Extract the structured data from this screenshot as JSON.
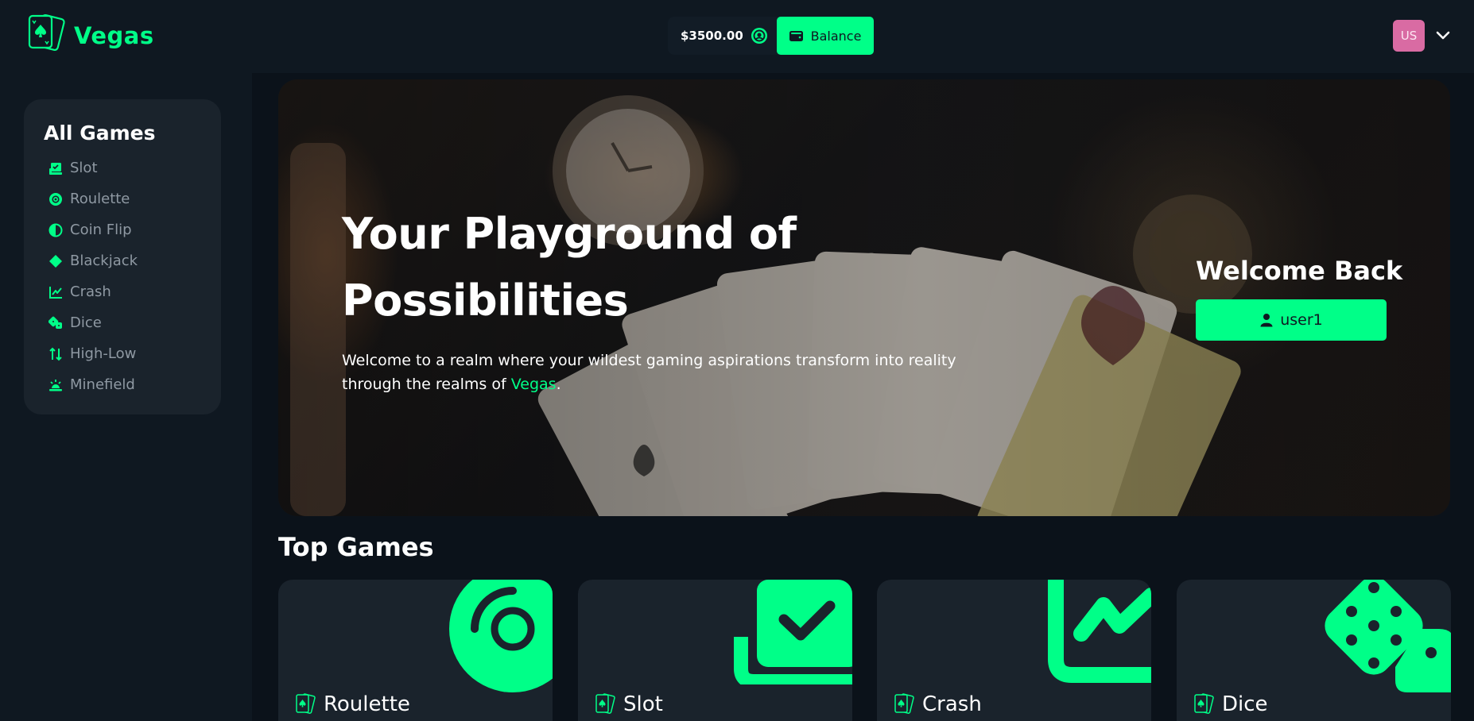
{
  "header": {
    "brand": "Vegas",
    "balance_amount": "$3500.00",
    "balance_label": "Balance",
    "avatar_initials": "US"
  },
  "sidebar": {
    "title": "All Games",
    "items": [
      {
        "label": "Slot",
        "icon": "slot-icon"
      },
      {
        "label": "Roulette",
        "icon": "roulette-icon"
      },
      {
        "label": "Coin Flip",
        "icon": "coin-flip-icon"
      },
      {
        "label": "Blackjack",
        "icon": "diamond-icon"
      },
      {
        "label": "Crash",
        "icon": "chart-line-icon"
      },
      {
        "label": "Dice",
        "icon": "dice-icon"
      },
      {
        "label": "High-Low",
        "icon": "arrows-up-down-icon"
      },
      {
        "label": "Minefield",
        "icon": "mine-icon"
      }
    ]
  },
  "hero": {
    "title": "Your Playground of Possibilities",
    "text_before": "Welcome to a realm where your wildest gaming aspirations transform into reality through the realms of ",
    "text_brand": "Vegas",
    "text_after": ".",
    "welcome_title": "Welcome Back",
    "username": "user1"
  },
  "top_games": {
    "title": "Top Games",
    "cards": [
      {
        "label": "Roulette",
        "icon": "roulette-icon"
      },
      {
        "label": "Slot",
        "icon": "slot-icon"
      },
      {
        "label": "Crash",
        "icon": "chart-line-icon"
      },
      {
        "label": "Dice",
        "icon": "dice-icon"
      }
    ]
  },
  "colors": {
    "accent": "#00ff88",
    "background": "#0f1821",
    "panel": "#1a232c",
    "avatar": "#d96ba3"
  }
}
